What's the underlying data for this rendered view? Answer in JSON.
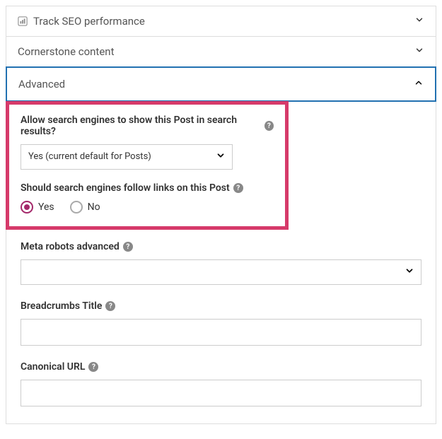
{
  "panels": {
    "seo": {
      "title": "Track SEO performance"
    },
    "cornerstone": {
      "title": "Cornerstone content"
    },
    "advanced": {
      "title": "Advanced"
    }
  },
  "advanced": {
    "allow_search": {
      "label": "Allow search engines to show this Post in search results?",
      "selected": "Yes (current default for Posts)"
    },
    "follow_links": {
      "label": "Should search engines follow links on this Post",
      "options": {
        "yes": "Yes",
        "no": "No"
      },
      "value": "yes"
    },
    "meta_robots": {
      "label": "Meta robots advanced",
      "selected": ""
    },
    "breadcrumbs": {
      "label": "Breadcrumbs Title",
      "value": ""
    },
    "canonical": {
      "label": "Canonical URL",
      "value": ""
    }
  }
}
